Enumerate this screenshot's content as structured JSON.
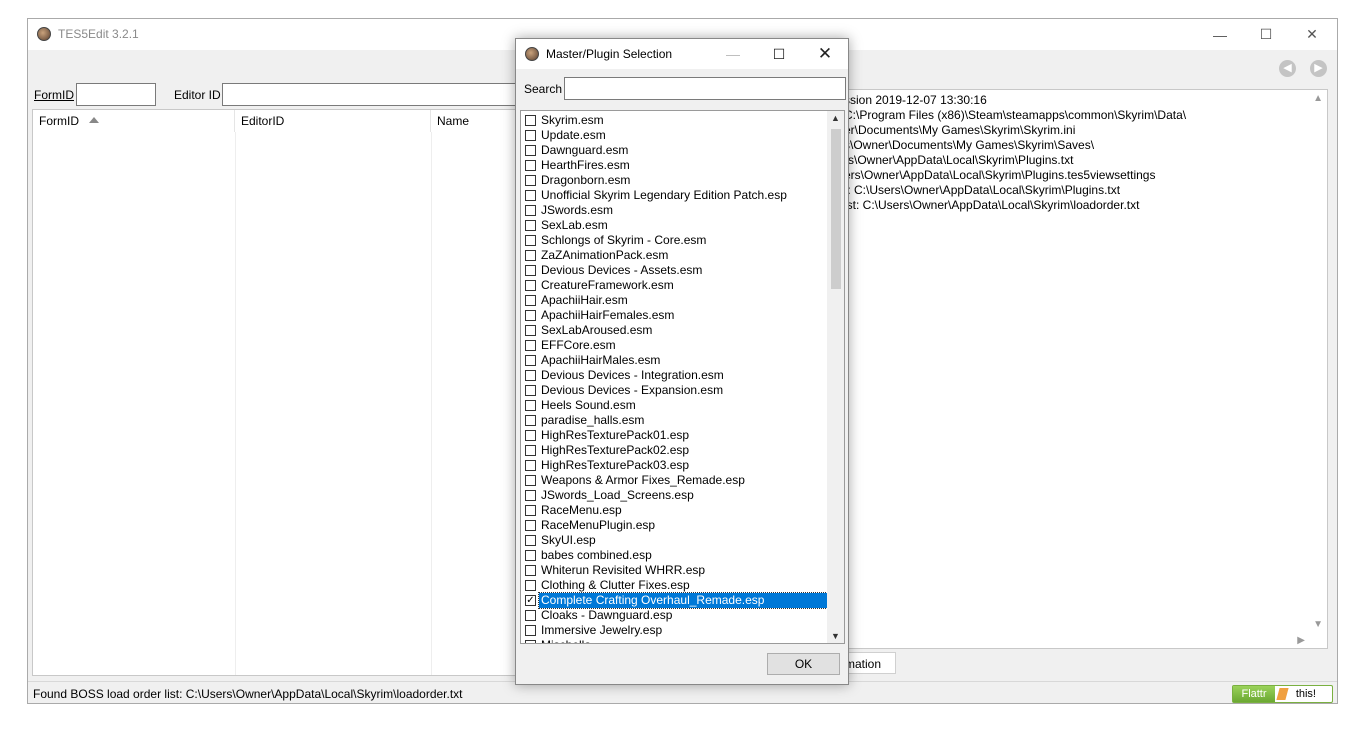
{
  "app": {
    "title": "TES5Edit 3.2.1"
  },
  "window_controls": {
    "minimize": "—",
    "maximize": "☐",
    "close": "✕"
  },
  "nav": {
    "back": "◀",
    "forward": "▶"
  },
  "filters": {
    "formid_label": "FormID",
    "editorid_label": "Editor ID"
  },
  "tree": {
    "columns": [
      "FormID",
      "EditorID",
      "Name"
    ]
  },
  "log": {
    "lines": [
      "ssion 2019-12-07 13:30:16",
      "C:\\Program Files (x86)\\Steam\\steamapps\\common\\Skyrim\\Data\\",
      "er\\Documents\\My Games\\Skyrim\\Skyrim.ini",
      "s\\Owner\\Documents\\My Games\\Skyrim\\Saves\\",
      "rs\\Owner\\AppData\\Local\\Skyrim\\Plugins.txt",
      "ers\\Owner\\AppData\\Local\\Skyrim\\Plugins.tes5viewsettings",
      "t: C:\\Users\\Owner\\AppData\\Local\\Skyrim\\Plugins.txt",
      "ist: C:\\Users\\Owner\\AppData\\Local\\Skyrim\\loadorder.txt"
    ]
  },
  "info_tab": {
    "label": "rmation"
  },
  "status": {
    "text": "Found BOSS load order list: C:\\Users\\Owner\\AppData\\Local\\Skyrim\\loadorder.txt"
  },
  "flattr": {
    "left": "Flattr",
    "right": "this!"
  },
  "dialog": {
    "title": "Master/Plugin Selection",
    "controls": {
      "minimize": "—",
      "maximize": "☐",
      "close": "✕"
    },
    "search_label": "Search",
    "search_value": "",
    "ok_label": "OK",
    "plugins": [
      {
        "name": "Skyrim.esm",
        "checked": false
      },
      {
        "name": "Update.esm",
        "checked": false
      },
      {
        "name": "Dawnguard.esm",
        "checked": false
      },
      {
        "name": "HearthFires.esm",
        "checked": false
      },
      {
        "name": "Dragonborn.esm",
        "checked": false
      },
      {
        "name": "Unofficial Skyrim Legendary Edition Patch.esp",
        "checked": false
      },
      {
        "name": "JSwords.esm",
        "checked": false
      },
      {
        "name": "SexLab.esm",
        "checked": false
      },
      {
        "name": "Schlongs of Skyrim - Core.esm",
        "checked": false
      },
      {
        "name": "ZaZAnimationPack.esm",
        "checked": false
      },
      {
        "name": "Devious Devices - Assets.esm",
        "checked": false
      },
      {
        "name": "CreatureFramework.esm",
        "checked": false
      },
      {
        "name": "ApachiiHair.esm",
        "checked": false
      },
      {
        "name": "ApachiiHairFemales.esm",
        "checked": false
      },
      {
        "name": "SexLabAroused.esm",
        "checked": false
      },
      {
        "name": "EFFCore.esm",
        "checked": false
      },
      {
        "name": "ApachiiHairMales.esm",
        "checked": false
      },
      {
        "name": "Devious Devices - Integration.esm",
        "checked": false
      },
      {
        "name": "Devious Devices - Expansion.esm",
        "checked": false
      },
      {
        "name": "Heels Sound.esm",
        "checked": false
      },
      {
        "name": "paradise_halls.esm",
        "checked": false
      },
      {
        "name": "HighResTexturePack01.esp",
        "checked": false
      },
      {
        "name": "HighResTexturePack02.esp",
        "checked": false
      },
      {
        "name": "HighResTexturePack03.esp",
        "checked": false
      },
      {
        "name": "Weapons & Armor Fixes_Remade.esp",
        "checked": false
      },
      {
        "name": "JSwords_Load_Screens.esp",
        "checked": false
      },
      {
        "name": "RaceMenu.esp",
        "checked": false
      },
      {
        "name": "RaceMenuPlugin.esp",
        "checked": false
      },
      {
        "name": "SkyUI.esp",
        "checked": false
      },
      {
        "name": "babes combined.esp",
        "checked": false
      },
      {
        "name": "Whiterun Revisited WHRR.esp",
        "checked": false
      },
      {
        "name": "Clothing & Clutter Fixes.esp",
        "checked": false
      },
      {
        "name": "Complete Crafting Overhaul_Remade.esp",
        "checked": true,
        "selected": true
      },
      {
        "name": "Cloaks - Dawnguard.esp",
        "checked": false
      },
      {
        "name": "Immersive Jewelry.esp",
        "checked": false
      },
      {
        "name": "Mischella...",
        "checked": false
      }
    ]
  }
}
